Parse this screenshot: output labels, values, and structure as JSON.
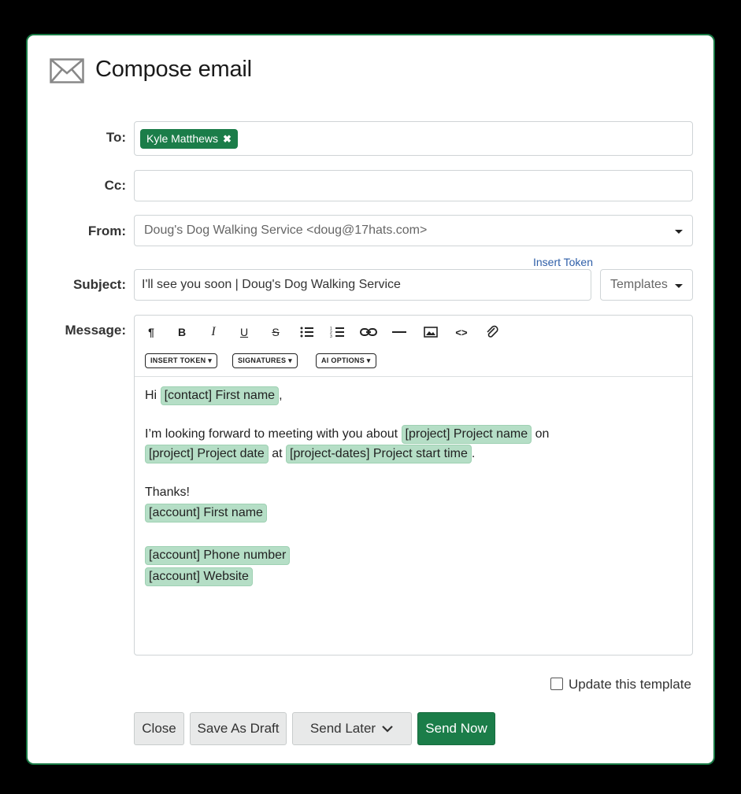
{
  "header": {
    "title": "Compose email",
    "icon": "envelope-icon"
  },
  "to": {
    "label": "To:",
    "recipients": [
      {
        "name": "Kyle Matthews",
        "remove_glyph": "✖"
      }
    ]
  },
  "cc": {
    "label": "Cc:",
    "value": ""
  },
  "from": {
    "label": "From:",
    "value": "Doug's Dog Walking Service <doug@17hats.com>"
  },
  "subject": {
    "label": "Subject:",
    "insert_token_link": "Insert Token",
    "value": "I'll see you soon | Doug's Dog Walking Service",
    "templates_label": "Templates"
  },
  "message": {
    "label": "Message:",
    "toolbar": [
      {
        "name": "paragraph-icon",
        "glyph": "¶"
      },
      {
        "name": "bold-icon",
        "glyph": "B"
      },
      {
        "name": "italic-icon",
        "glyph": "I"
      },
      {
        "name": "underline-icon",
        "glyph": "U"
      },
      {
        "name": "strikethrough-icon",
        "glyph": "S"
      },
      {
        "name": "bullet-list-icon",
        "glyph": "≔"
      },
      {
        "name": "numbered-list-icon",
        "glyph": "≔"
      },
      {
        "name": "link-icon",
        "glyph": "⛓"
      },
      {
        "name": "horizontal-rule-icon",
        "glyph": "—"
      },
      {
        "name": "image-icon",
        "glyph": "▣"
      },
      {
        "name": "code-icon",
        "glyph": "<>"
      },
      {
        "name": "attachment-icon",
        "glyph": "🔗"
      }
    ],
    "insert_token_pill": "INSERT TOKEN ▾",
    "signatures_pill": "SIGNATURES ▾",
    "ai_options_pill": "AI OPTIONS ▾",
    "body": {
      "greeting": "Hi",
      "contact_first_name": "[contact] First name",
      "comma": ",",
      "line2_text": "I’m looking forward to meeting with you about",
      "project_name": "[project] Project name",
      "on": "on",
      "project_date": "[project] Project date",
      "at": "at",
      "project_start_time": "[project-dates] Project start time",
      "period": ".",
      "thanks": "Thanks!",
      "account_first_name": "[account] First name",
      "account_phone": "[account] Phone number",
      "account_website": "[account] Website"
    }
  },
  "update_template_label": "Update this template",
  "update_template_checked": false,
  "buttons": {
    "close": "Close",
    "save_draft": "Save As Draft",
    "send_later": "Send Later",
    "send_now": "Send Now"
  },
  "colors": {
    "brand_green": "#1b7d49",
    "token_bg": "#b5dec6",
    "link_blue": "#2f5fa8"
  }
}
